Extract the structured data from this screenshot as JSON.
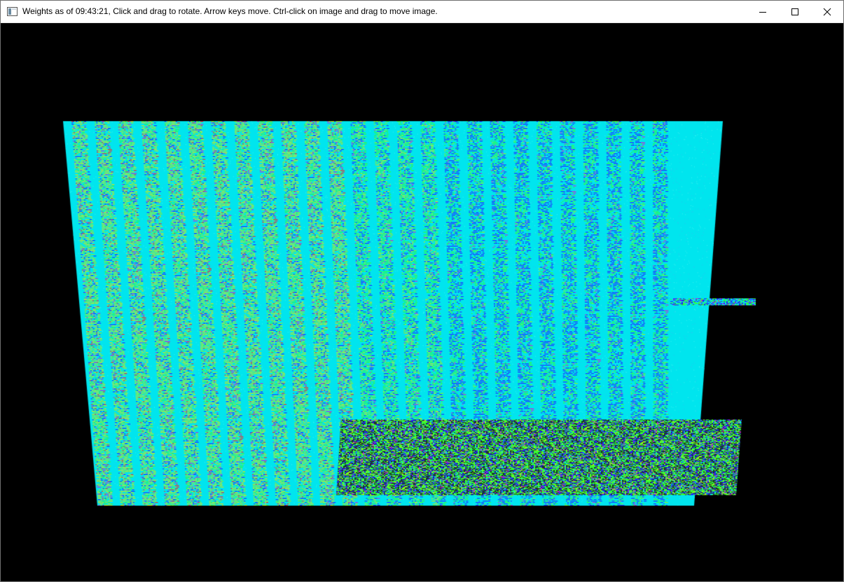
{
  "window": {
    "title": "Weights as of 09:43:21, Click and drag to rotate. Arrow keys move.  Ctrl-click on image and drag to move image.",
    "controls": {
      "minimize_icon": "minimize-icon",
      "maximize_icon": "maximize-icon",
      "close_icon": "close-icon"
    }
  },
  "visualization": {
    "background_color": "#000000",
    "palette": {
      "cyan": "#00e5ee",
      "light_cyan": "#3df0f0",
      "green": "#33ff33",
      "lime": "#99ee22",
      "yellow": "#e6e600",
      "blue": "#2222ff",
      "magenta": "#cc22cc",
      "red": "#ff2222"
    }
  }
}
